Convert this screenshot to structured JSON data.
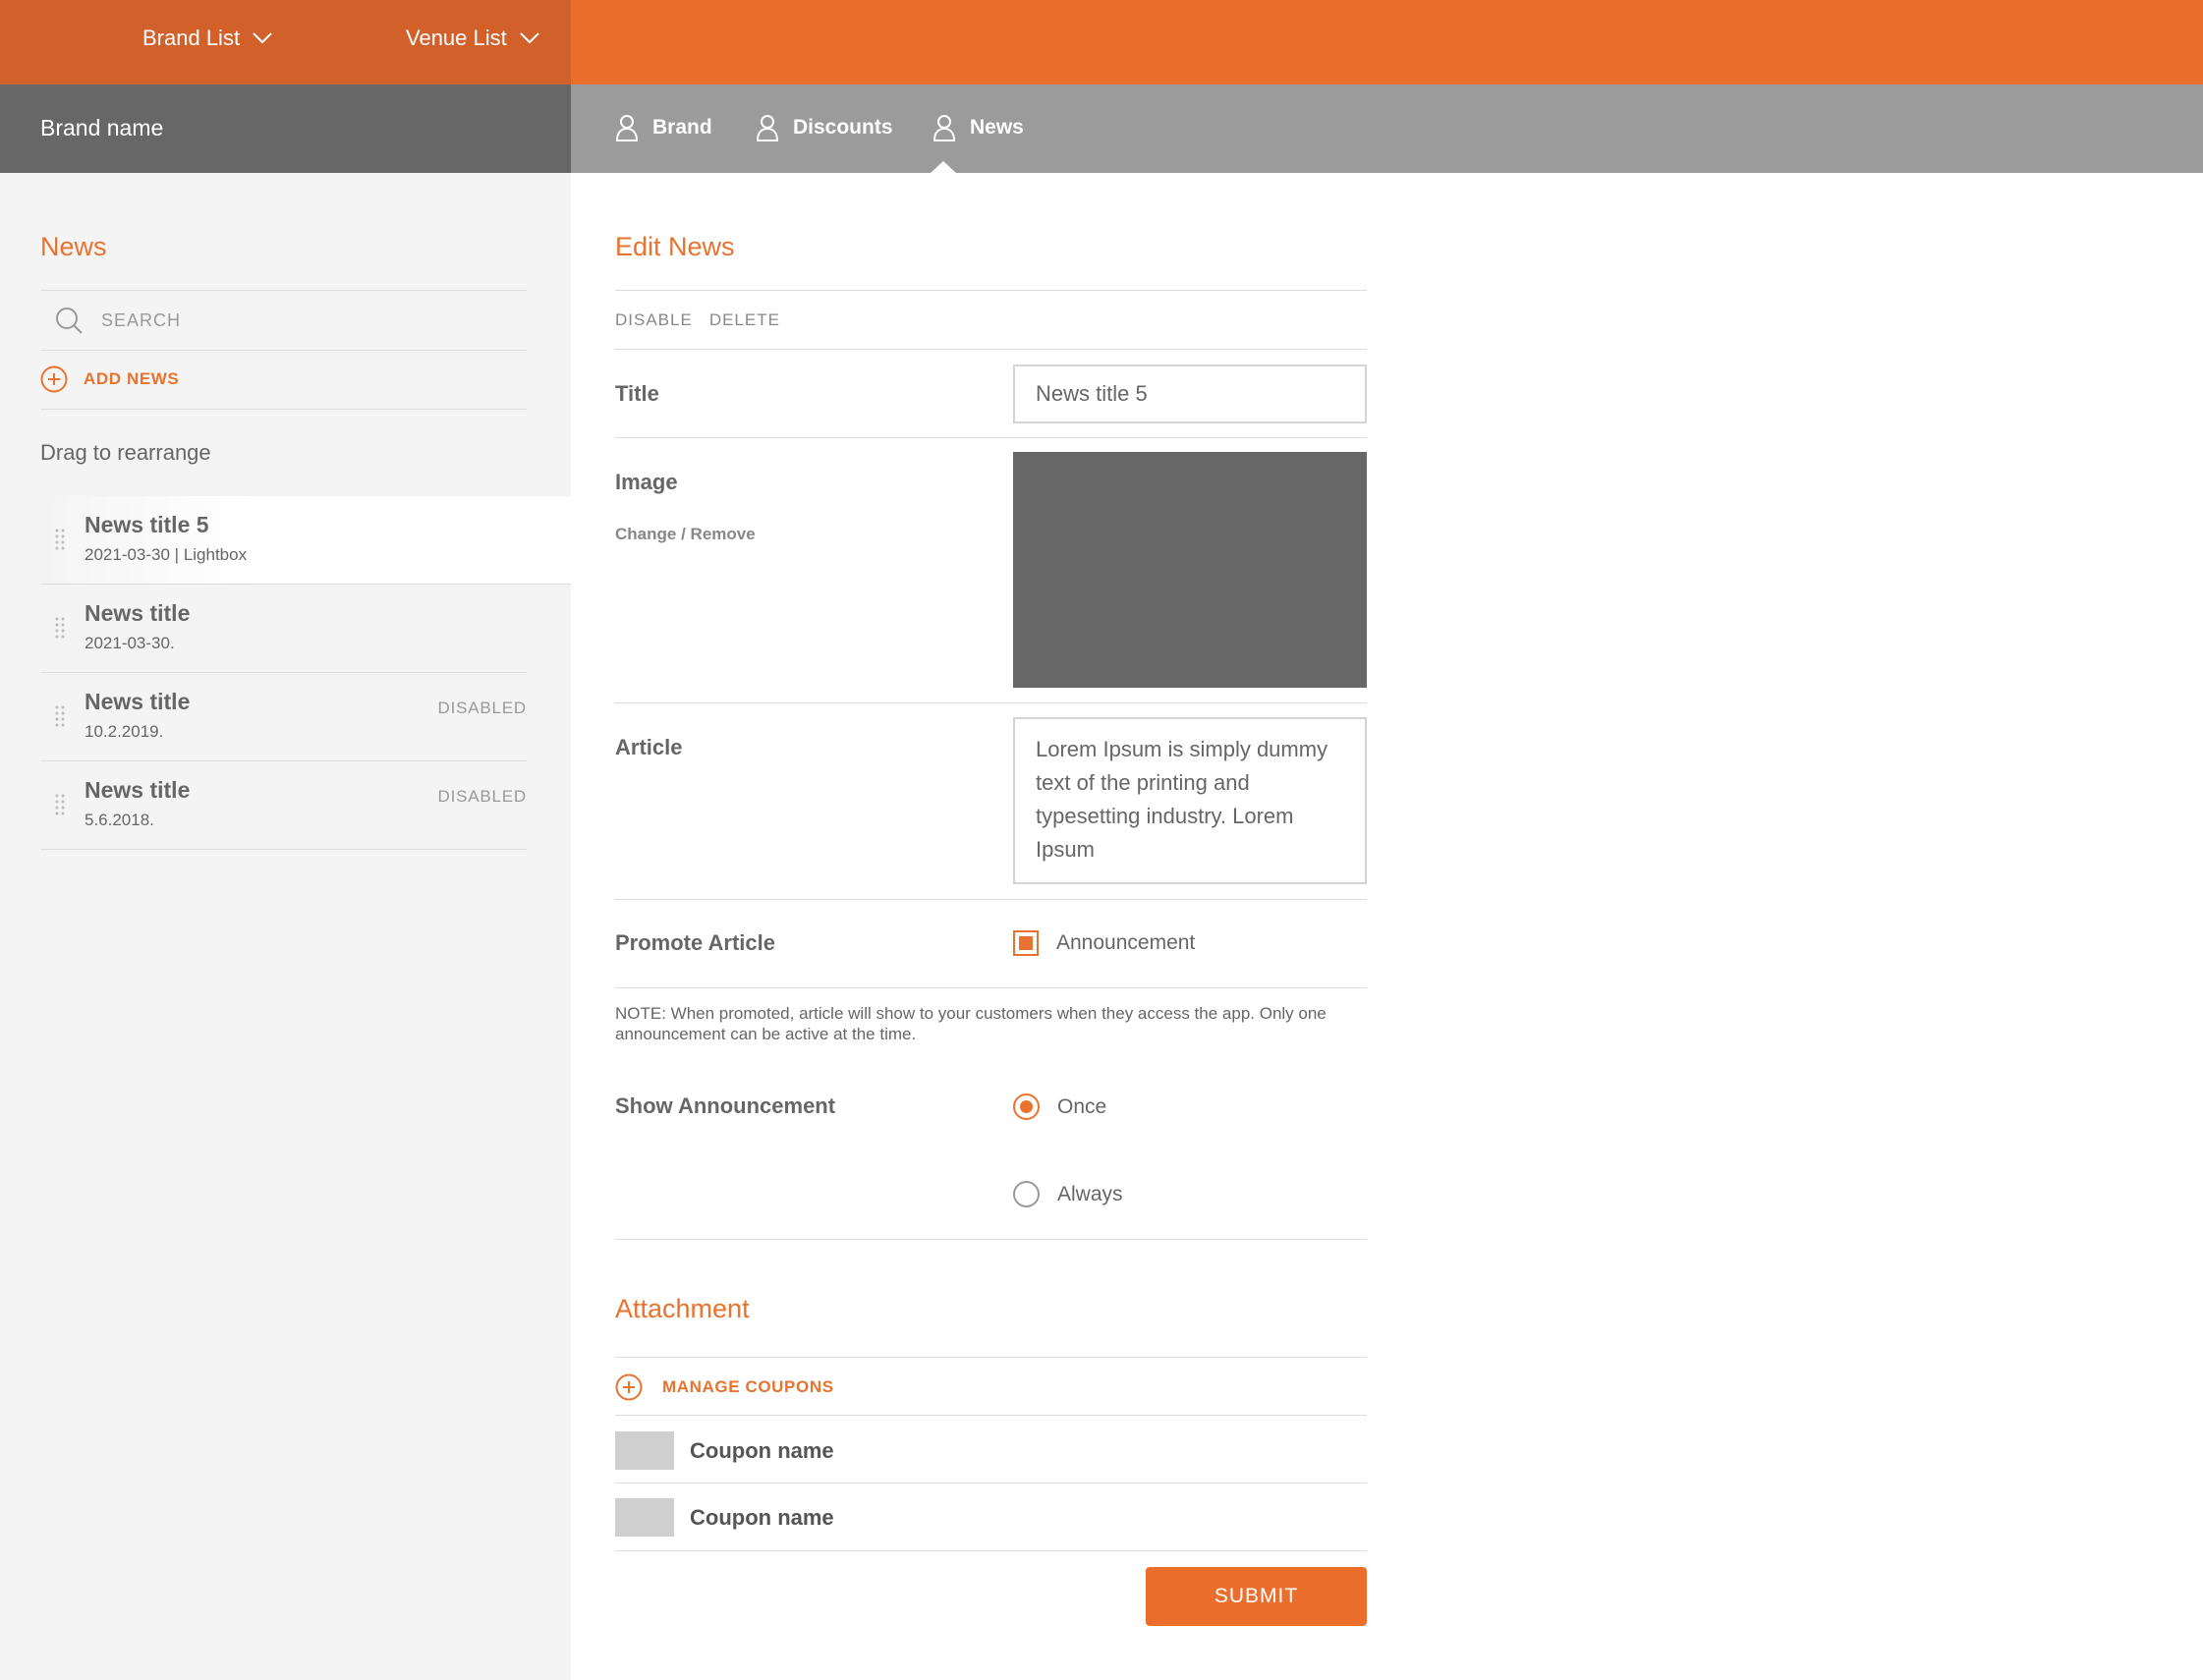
{
  "topbar": {
    "brand_list_label": "Brand List",
    "venue_list_label": "Venue List",
    "bg_color": "#ec6e2c",
    "left_bg_color": "#d2602a"
  },
  "subbar": {
    "brand_name": "Brand name",
    "tabs": [
      {
        "label": "Brand",
        "icon": "user-icon"
      },
      {
        "label": "Discounts",
        "icon": "user-icon"
      },
      {
        "label": "News",
        "icon": "user-icon",
        "active": true
      }
    ]
  },
  "sidebar": {
    "title": "News",
    "search_placeholder": "SEARCH",
    "add_news_label": "ADD NEWS",
    "drag_hint": "Drag to rearrange",
    "items": [
      {
        "title": "News title 5",
        "meta": "2021-03-30 | Lightbox",
        "status": "",
        "active": true
      },
      {
        "title": "News title",
        "meta": "2021-03-30.",
        "status": ""
      },
      {
        "title": "News title",
        "meta": "10.2.2019.",
        "status": "DISABLED"
      },
      {
        "title": "News title",
        "meta": "5.6.2018.",
        "status": "DISABLED"
      }
    ]
  },
  "editor": {
    "title": "Edit News",
    "actions": [
      "DISABLE",
      "DELETE"
    ],
    "title_label": "Title",
    "title_value": "News title 5",
    "image_label": "Image",
    "image_change": "Change",
    "image_sep": "/",
    "image_remove": "Remove",
    "article_label": "Article",
    "article_value": "Lorem Ipsum is simply dummy text of the printing and typesetting industry. Lorem Ipsum",
    "promote_label": "Promote Article",
    "announcement_label": "Announcement",
    "announcement_checked": true,
    "note": "NOTE: When promoted, article will show to your customers when they access the app. Only one announcement can be active at the time.",
    "show_label": "Show Announcement",
    "show_options": [
      {
        "label": "Once",
        "selected": true
      },
      {
        "label": "Always",
        "selected": false
      }
    ],
    "attachment_title": "Attachment",
    "manage_coupons_label": "MANAGE COUPONS",
    "coupons": [
      "Coupon name",
      "Coupon name"
    ],
    "submit_label": "SUBMIT"
  },
  "colors": {
    "accent": "#e8732f",
    "image_placeholder": "#676767"
  }
}
